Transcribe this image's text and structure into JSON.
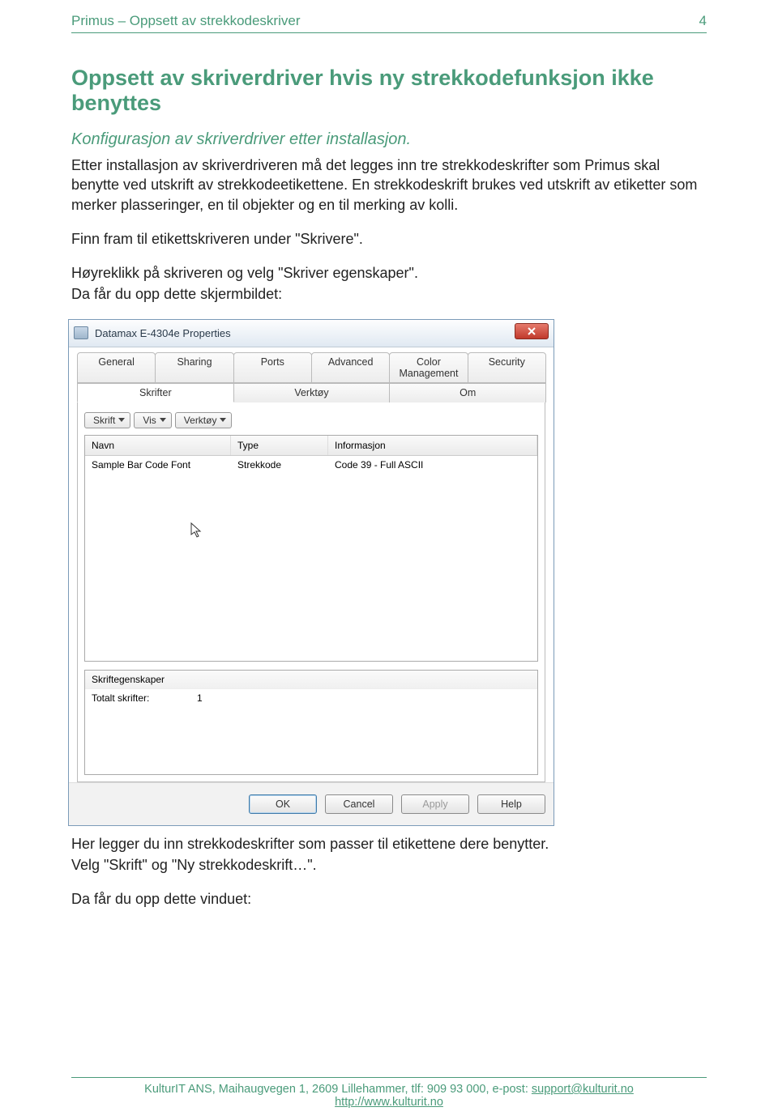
{
  "header": {
    "left": "Primus – Oppsett av strekkodeskriver",
    "page_number": "4"
  },
  "body": {
    "h1": "Oppsett av skriverdriver hvis ny strekkodefunksjon ikke benyttes",
    "h2": "Konfigurasjon av skriverdriver etter installasjon.",
    "p1": "Etter installasjon av skriverdriveren må det legges inn tre strekkodeskrifter som Primus skal benytte ved utskrift av strekkodeetikettene. En strekkodeskrift brukes ved utskrift av etiketter som merker plasseringer, en til objekter og en til merking av kolli.",
    "p2": "Finn fram til etikettskriveren under \"Skrivere\".",
    "p3": "Høyreklikk på skriveren og velg \"Skriver egenskaper\".",
    "p4": "Da får du opp dette skjermbildet:",
    "p5": "Her legger du inn strekkodeskrifter som passer til etikettene dere benytter.",
    "p6": "Velg \"Skrift\" og \"Ny strekkodeskrift…\".",
    "p7": "Da får du opp dette vinduet:"
  },
  "dialog": {
    "title": "Datamax E-4304e Properties",
    "tabs_top": [
      "General",
      "Sharing",
      "Ports",
      "Advanced",
      "Color Management",
      "Security"
    ],
    "tabs_bottom": [
      "Skrifter",
      "Verktøy",
      "Om"
    ],
    "toolbar": {
      "skrift": "Skrift",
      "vis": "Vis",
      "verktoy": "Verktøy"
    },
    "columns": {
      "c1": "Navn",
      "c2": "Type",
      "c3": "Informasjon"
    },
    "row1": {
      "name": "Sample Bar Code Font",
      "type": "Strekkode",
      "info": "Code 39 - Full ASCII"
    },
    "props": {
      "head": "Skriftegenskaper",
      "label": "Totalt skrifter:",
      "value": "1"
    },
    "buttons": {
      "ok": "OK",
      "cancel": "Cancel",
      "apply": "Apply",
      "help": "Help"
    }
  },
  "footer": {
    "line1_a": "KulturIT ANS, Maihaugvegen 1, 2609 Lillehammer, tlf: 909 93 000, e-post: ",
    "line1_link": "support@kulturit.no",
    "line2": "http://www.kulturit.no"
  }
}
